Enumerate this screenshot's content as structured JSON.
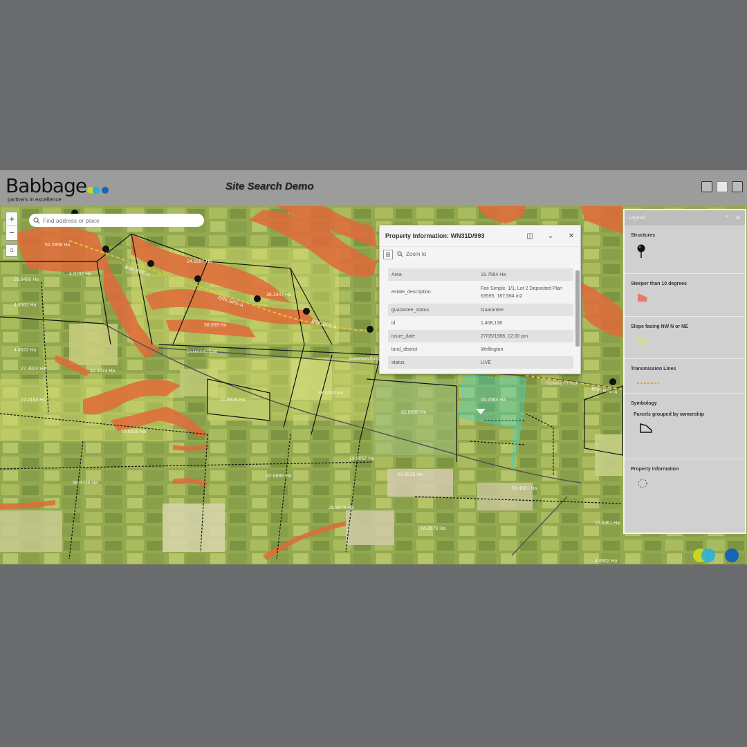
{
  "app": {
    "logo_text": "Babbage",
    "logo_tagline": "partners in excellence",
    "title": "Site Search Demo"
  },
  "header_icons": [
    "basemap-icon",
    "layers-icon",
    "grid-icon"
  ],
  "search": {
    "placeholder": "Find address or place"
  },
  "map_controls": {
    "zoom_in": "+",
    "zoom_out": "−",
    "home": "⌂"
  },
  "map": {
    "transmission_lines": [
      "BRK-BPE-A",
      "BRK-BPE-A",
      "BRK-BPE-A",
      "BRK-BPE-A"
    ],
    "roads": [
      "Dickenson Road",
      "Dickenson Road",
      "Dickenson Road"
    ],
    "parcel_labels": [
      "52.2858 Ha",
      "24.1657 Ha",
      "4.9797 Ha",
      "28.8496 Ha",
      "36.3347 Ha",
      "58.659 Ha",
      "4.8362 Ha",
      "38.6043 Ha",
      "21.9929 Ha",
      "62.8596 Ha",
      "27.2154 Ha",
      "75.6528 Ha",
      "62.6889 Ha",
      "19.9052 Ha",
      "16.7564 Ha",
      "82.8525 Ha",
      "63.4561 Ha",
      "28.9574 Ha",
      "14.3579 Ha",
      "58.4738 Ha",
      "4.4522 Ha",
      "32.3474 Ha",
      "27.3924 Ha",
      "4.8362 Ha",
      "15.8361 Ha"
    ],
    "colors": {
      "farmland": "#8fa64a",
      "steeper_than_10_degrees": "#e06a3a",
      "slope_facing_nw_n_ne": "#d8e070",
      "transmission_line": "#e8c23a",
      "selected_parcel": "#38d6c8",
      "parcel_boundary": "#111111"
    }
  },
  "popup": {
    "title": "Property Information: WN31D/993",
    "actions": [
      "dock-icon",
      "collapse-icon",
      "close-icon"
    ],
    "zoom_to": "Zoom to",
    "rows": [
      {
        "key": "Area",
        "value": "16.7564 Ha"
      },
      {
        "key": "estate_description",
        "value": "Fee Simple, 1/1, Lot 2 Deposited Plan 63595, 167,564 m2"
      },
      {
        "key": "guarantee_status",
        "value": "Guarantee"
      },
      {
        "key": "id",
        "value": "1,408,136"
      },
      {
        "key": "issue_date",
        "value": "27/05/1988, 12:00 pm"
      },
      {
        "key": "land_district",
        "value": "Wellington"
      },
      {
        "key": "status",
        "value": "LIVE"
      }
    ]
  },
  "legend": {
    "title": "Legend",
    "sections": [
      {
        "title": "Structures",
        "symbol": "pin-icon"
      },
      {
        "title": "Steeper than 10 degrees",
        "symbol": "polygon-red",
        "color": "#e87a6a"
      },
      {
        "title": "Slope facing NW N or NE",
        "symbol": "polygon-yellow",
        "color": "#d8da9a"
      },
      {
        "title": "Transmission Lines",
        "symbol": "line-dashed",
        "color": "#e8a534"
      },
      {
        "title": "Symbology",
        "subtitle": "Parcels grouped by ownership",
        "symbol": "parcel-outline"
      },
      {
        "title": "Property Information",
        "symbol": "dotted-circle"
      }
    ]
  }
}
